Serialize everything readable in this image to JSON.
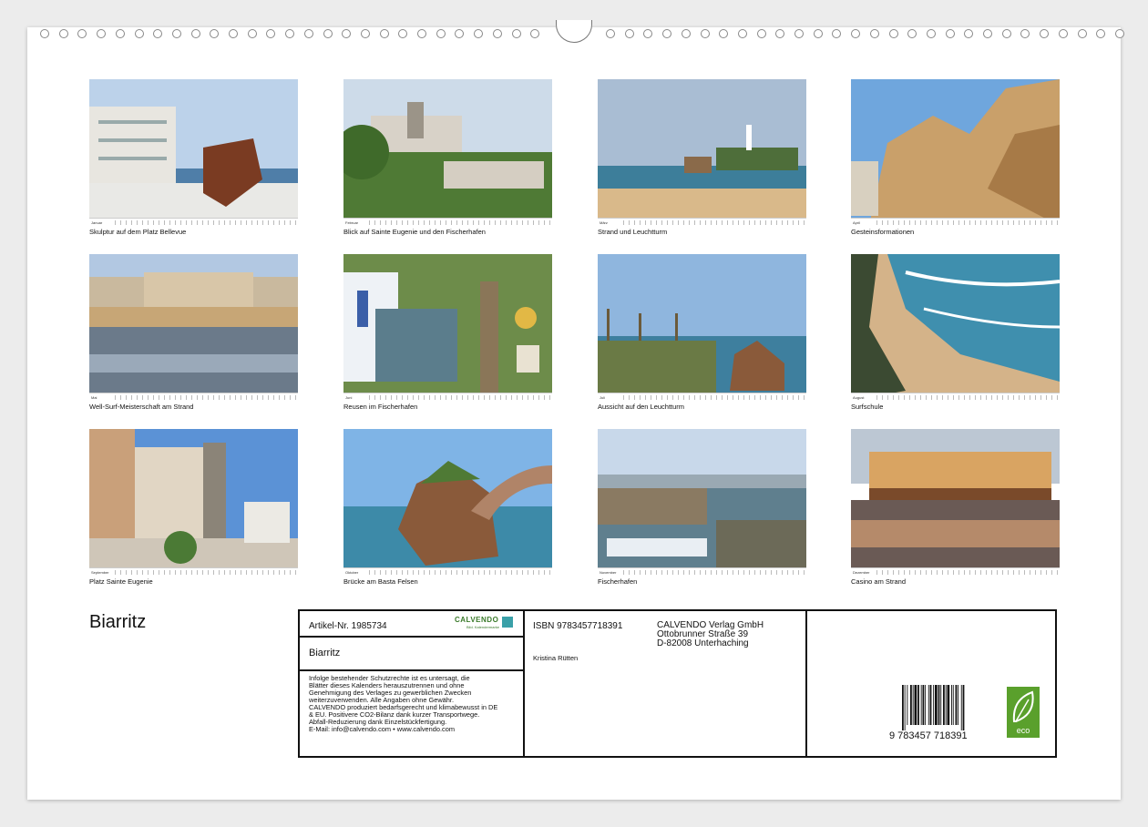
{
  "calendar_title": "Biarritz",
  "photos": [
    {
      "caption": "Skulptur auf dem Platz Bellevue",
      "month": "Januar"
    },
    {
      "caption": "Blick auf Sainte Eugenie und den Fischerhafen",
      "month": "Februar"
    },
    {
      "caption": "Strand und Leuchtturm",
      "month": "März"
    },
    {
      "caption": "Gesteinsformationen",
      "month": "April"
    },
    {
      "caption": "Well-Surf-Meisterschaft am Strand",
      "month": "Mai"
    },
    {
      "caption": "Reusen im Fischerhafen",
      "month": "Juni"
    },
    {
      "caption": "Aussicht auf den Leuchtturm",
      "month": "Juli"
    },
    {
      "caption": "Surfschule",
      "month": "August"
    },
    {
      "caption": "Platz Sainte Eugenie",
      "month": "September"
    },
    {
      "caption": "Brücke am Basta Felsen",
      "month": "Oktober"
    },
    {
      "caption": "Fischerhafen",
      "month": "November"
    },
    {
      "caption": "Casino am Strand",
      "month": "Dezember"
    }
  ],
  "info": {
    "article": "Artikel-Nr. 1985734",
    "logo": "CALVENDO",
    "logo_sub": "Bild. Kalendermarke",
    "box_title": "Biarritz",
    "legal": [
      "Infolge bestehender Schutzrechte ist es untersagt, die",
      "Blätter dieses Kalenders herauszutrennen und ohne",
      "Genehmigung des Verlages zu gewerblichen Zwecken",
      "weiterzuverwenden. Alle Angaben ohne Gewähr.",
      "CALVENDO produziert bedarfsgerecht und klimabewusst in DE",
      "& EU. Positivere CO2-Bilanz dank kurzer Transportwege.",
      "Abfall-Reduzierung dank Einzelstückfertigung.",
      "E-Mail: info@calvendo.com • www.calvendo.com"
    ],
    "isbn": "ISBN 9783457718391",
    "author": "Kristina Rütten",
    "publisher": [
      "CALVENDO Verlag GmbH",
      "Ottobrunner Straße 39",
      "D-82008 Unterhaching"
    ],
    "barcode_number": "9 783457 718391",
    "eco_label": "eco"
  }
}
